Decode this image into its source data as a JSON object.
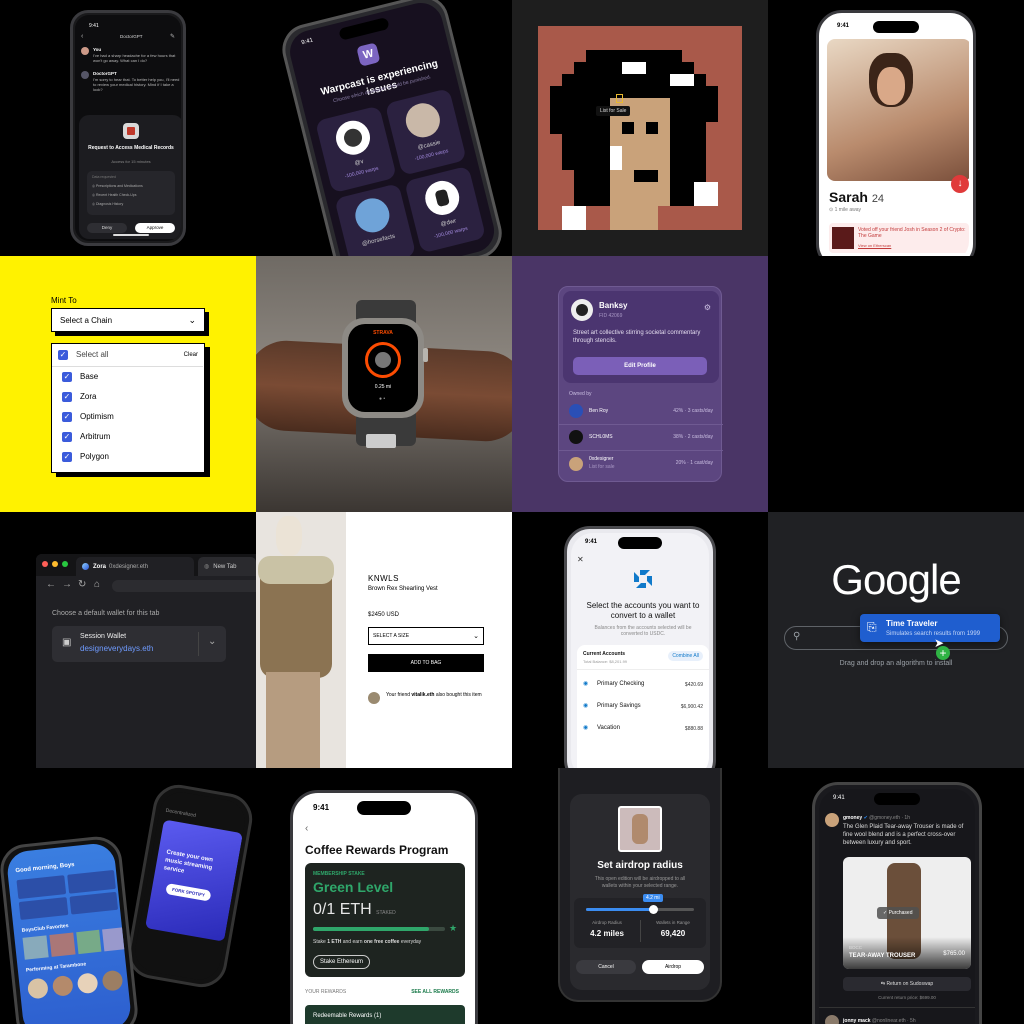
{
  "t1": {
    "time": "9:41",
    "header": "DoctorGPT",
    "msgs": [
      {
        "who": "You",
        "text": "I've had a sharp headache for a few hours that won't go away. What can I do?"
      },
      {
        "who": "DoctorGPT",
        "text": "I'm sorry to hear that. To better help you, I'll need to review your medical history. Mind if I take a look?"
      }
    ],
    "card_title": "Request to Access Medical Records",
    "card_sub": "Access for 15 minutes",
    "access_heading": "Data requested",
    "access_items": [
      "Prescriptions and Medications",
      "Recent Health Check-Ups",
      "Diagnosis History"
    ],
    "deny": "Deny",
    "approve": "Approve"
  },
  "t2": {
    "time": "9:41",
    "title": "Warpcast is experiencing issues",
    "subtitle": "Choose which developer should be punished.",
    "cards": [
      {
        "name": "@v",
        "warps": "-100,000 warps"
      },
      {
        "name": "@cassie",
        "warps": "-100,000 warps"
      },
      {
        "name": "@horsefacts",
        "warps": ""
      },
      {
        "name": "@dwr",
        "warps": "-100,000 warps"
      }
    ]
  },
  "t3": {
    "tooltip": "List for Sale"
  },
  "t4": {
    "time": "9:41",
    "name": "Sarah",
    "age": "24",
    "distance": "1 mile away",
    "voted": "Voted off your friend Josh in Season 2 of Crypto: The Game",
    "view": "View on Etherscan"
  },
  "t5": {
    "label": "Mint To",
    "select": "Select a Chain",
    "select_all": "Select all",
    "clear": "Clear",
    "chains": [
      "Base",
      "Zora",
      "Optimism",
      "Arbitrum",
      "Polygon"
    ]
  },
  "t6": {
    "brand": "STRAVA",
    "distance": "0.25 mi"
  },
  "t7": {
    "name": "Banksy",
    "fid": "FID 42069",
    "bio": "Street art collective stirring societal commentary through stencils.",
    "edit": "Edit Profile",
    "owned_by": "Owned by",
    "owners": [
      {
        "name": "Ben Roy",
        "sub": "",
        "stat": "42% · 3 casts/day"
      },
      {
        "name": "SCHL0MS",
        "sub": "",
        "stat": "38% · 2 casts/day"
      },
      {
        "name": "0xdesigner",
        "sub": "List for sale",
        "stat": "20% · 1 cast/day"
      }
    ]
  },
  "t9": {
    "tab1": "Zora",
    "tab1_sub": "0xdesigner.eth",
    "tab2": "New Tab",
    "prompt": "Choose a default wallet for this tab",
    "wallet_label": "Session Wallet",
    "wallet_value": "designeverydays.eth"
  },
  "t10": {
    "brand": "KNWLS",
    "product": "Brown Rex Shearling Vest",
    "price": "$2450 USD",
    "size": "SELECT A SIZE",
    "add": "ADD TO BAG",
    "friend_pre": "Your friend ",
    "friend": "vitalik.eth",
    "friend_post": " also bought this item"
  },
  "t11": {
    "time": "9:41",
    "title": "Select the accounts you want to convert to a wallet",
    "sub": "Balances from the accounts selected will be converted to USDC.",
    "section": "Current Accounts",
    "total": "Total Balance: $8,201.99",
    "combine": "Combine All",
    "accounts": [
      {
        "name": "Primary Checking",
        "amount": "$420.69"
      },
      {
        "name": "Primary Savings",
        "amount": "$6,900.42"
      },
      {
        "name": "Vacation",
        "amount": "$880.88"
      }
    ]
  },
  "t12": {
    "logo": "Google",
    "popup_title": "Time Traveler",
    "popup_sub": "Simulates search results from 1999",
    "hint": "Drag and drop an algorithm to install"
  },
  "t13": {
    "greeting": "Good morning, Boys",
    "section": "BoysClub Favorites",
    "performing": "Performing at Tarambone",
    "right_title": "Create your own music streaming service",
    "right_btn": "FORK SPOTIFY",
    "right_header": "Decentralized"
  },
  "t14": {
    "time": "9:41",
    "title": "Coffee Rewards Program",
    "stake_label": "MEMBERSHIP STAKE",
    "level": "Green Level",
    "eth": "0/1 ETH",
    "staked": "STAKED",
    "earn_pre": "Stake ",
    "earn_b1": "1 ETH",
    "earn_mid": " and earn ",
    "earn_b2": "one free coffee",
    "earn_post": " everyday",
    "stake_btn": "Stake Ethereum",
    "rewards": "YOUR REWARDS",
    "see_all": "SEE ALL REWARDS",
    "redeemable": "Redeemable Rewards (1)",
    "progress": 0.88
  },
  "t15": {
    "title": "Set airdrop radius",
    "desc": "This open edition will be airdropped to all wallets within your selected range.",
    "bubble": "4.2 mi",
    "radius_label": "Airdrop Radius",
    "radius": "4.2 miles",
    "wallets_label": "Wallets in Range",
    "wallets": "69,420",
    "cancel": "Cancel",
    "airdrop": "Airdrop",
    "slider": 0.62
  },
  "t16": {
    "time": "9:41",
    "user": "gmoney",
    "handle": "@gmoney.eth · 1h",
    "text": "The Glen Plaid Tear-away Trouser is made of fine wool blend and is a perfect cross-over between luxury and sport.",
    "purchased": "Purchased",
    "item_brand": "BOCC",
    "item_name": "TEAR-AWAY TROUSER",
    "item_price": "$765.00",
    "return_btn": "Return on Sudoswap",
    "return_price": "Current return price: $699.00",
    "next_user": "jonny mack",
    "next_handle": "@nonlinear.eth · 5h"
  }
}
